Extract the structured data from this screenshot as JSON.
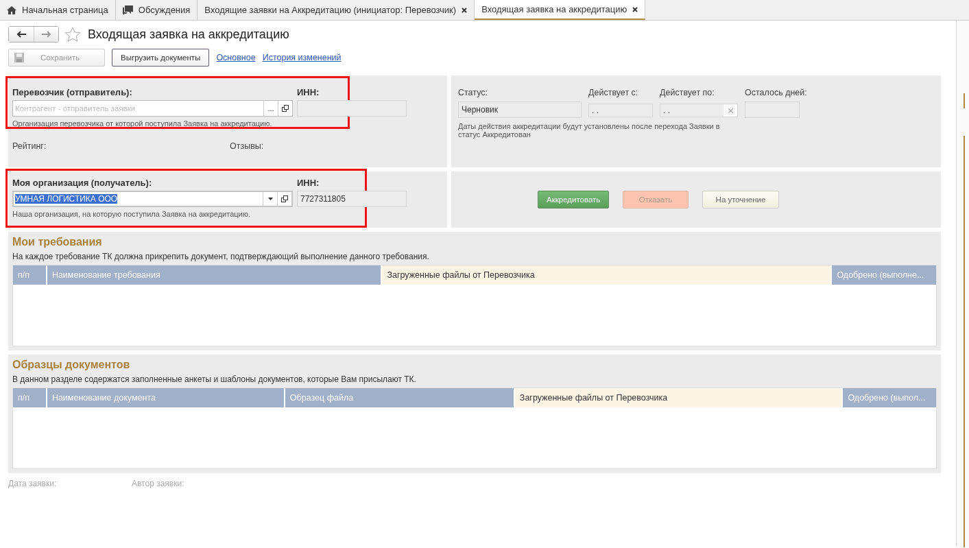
{
  "tabs": [
    {
      "label": "Начальная страница",
      "kind": "home",
      "selected": false,
      "closable": false
    },
    {
      "label": "Обсуждения",
      "kind": "chat",
      "selected": false,
      "closable": false
    },
    {
      "label": "Входящие заявки на Аккредитацию (инициатор: Перевозчик)",
      "kind": "plain",
      "selected": false,
      "closable": true
    },
    {
      "label": "Входящая заявка на аккредитацию",
      "kind": "plain",
      "selected": true,
      "closable": true
    }
  ],
  "form": {
    "title": "Входящая заявка на аккредитацию",
    "favorite": false
  },
  "toolbar": {
    "save": {
      "label": "Сохранить",
      "disabled": true
    },
    "export": {
      "label": "Выгрузить документы"
    },
    "links": [
      "Основное",
      "История изменений"
    ]
  },
  "sender": {
    "label": "Перевозчик (отправитель):",
    "placeholder": "Контрагент - отправитель заявки",
    "select_button": "...",
    "hint": "Организация перевозчика от которой поступила Заявка на аккредитацию.",
    "inn_label": "ИНН:",
    "highlighted": true
  },
  "rating": {
    "label": "Рейтинг:",
    "reviews_label": "Отзывы:"
  },
  "receiver": {
    "label": "Моя организация (получатель):",
    "value": "УМНАЯ ЛОГИСТИКА ООО",
    "value_selected": true,
    "hint": "Наша организация, на которую поступила Заявка на аккредитацию.",
    "inn_label": "ИНН:",
    "inn": "7727311805",
    "highlighted": true
  },
  "status": {
    "label": "Статус:",
    "value": "Черновик",
    "from_label": "Действует с:",
    "from": " .  .",
    "to_label": "Действует по:",
    "to": " .  .",
    "days_label": "Осталось дней:",
    "note": "Даты действия аккредитации будут установлены после перехода Заявки в статус Аккредитован"
  },
  "actions": [
    {
      "label": "Аккредитовать",
      "kind": "accept"
    },
    {
      "label": "Отказать",
      "kind": "reject"
    },
    {
      "label": "На уточнение",
      "kind": "clarify"
    }
  ],
  "sections": [
    {
      "title": "Мои требования",
      "description": "На каждое требование ТК должна прикрепить документ, подтверждающий выполнение данного требования.",
      "columns": [
        {
          "label": "п/п",
          "kind": "plain"
        },
        {
          "label": "Наименование требования",
          "kind": "plain"
        },
        {
          "label": "Загруженные файлы от Перевозчика",
          "kind": "files"
        },
        {
          "label": "Одобрено (выполне...",
          "kind": "plain"
        }
      ]
    },
    {
      "title": "Образцы документов",
      "description": "В данном разделе содержатся заполненные анкеты и шаблоны документов, которые Вам присылают ТК.",
      "columns": [
        {
          "label": "п/п",
          "kind": "plain"
        },
        {
          "label": "Наименование документа",
          "kind": "plain"
        },
        {
          "label": "Образец файла",
          "kind": "plain"
        },
        {
          "label": "Загруженные файлы от Перевозчика",
          "kind": "files"
        },
        {
          "label": "Одобрено (выпол...",
          "kind": "plain"
        }
      ]
    }
  ],
  "footer": [
    "Дата заявки:",
    "Автор заявки:"
  ]
}
